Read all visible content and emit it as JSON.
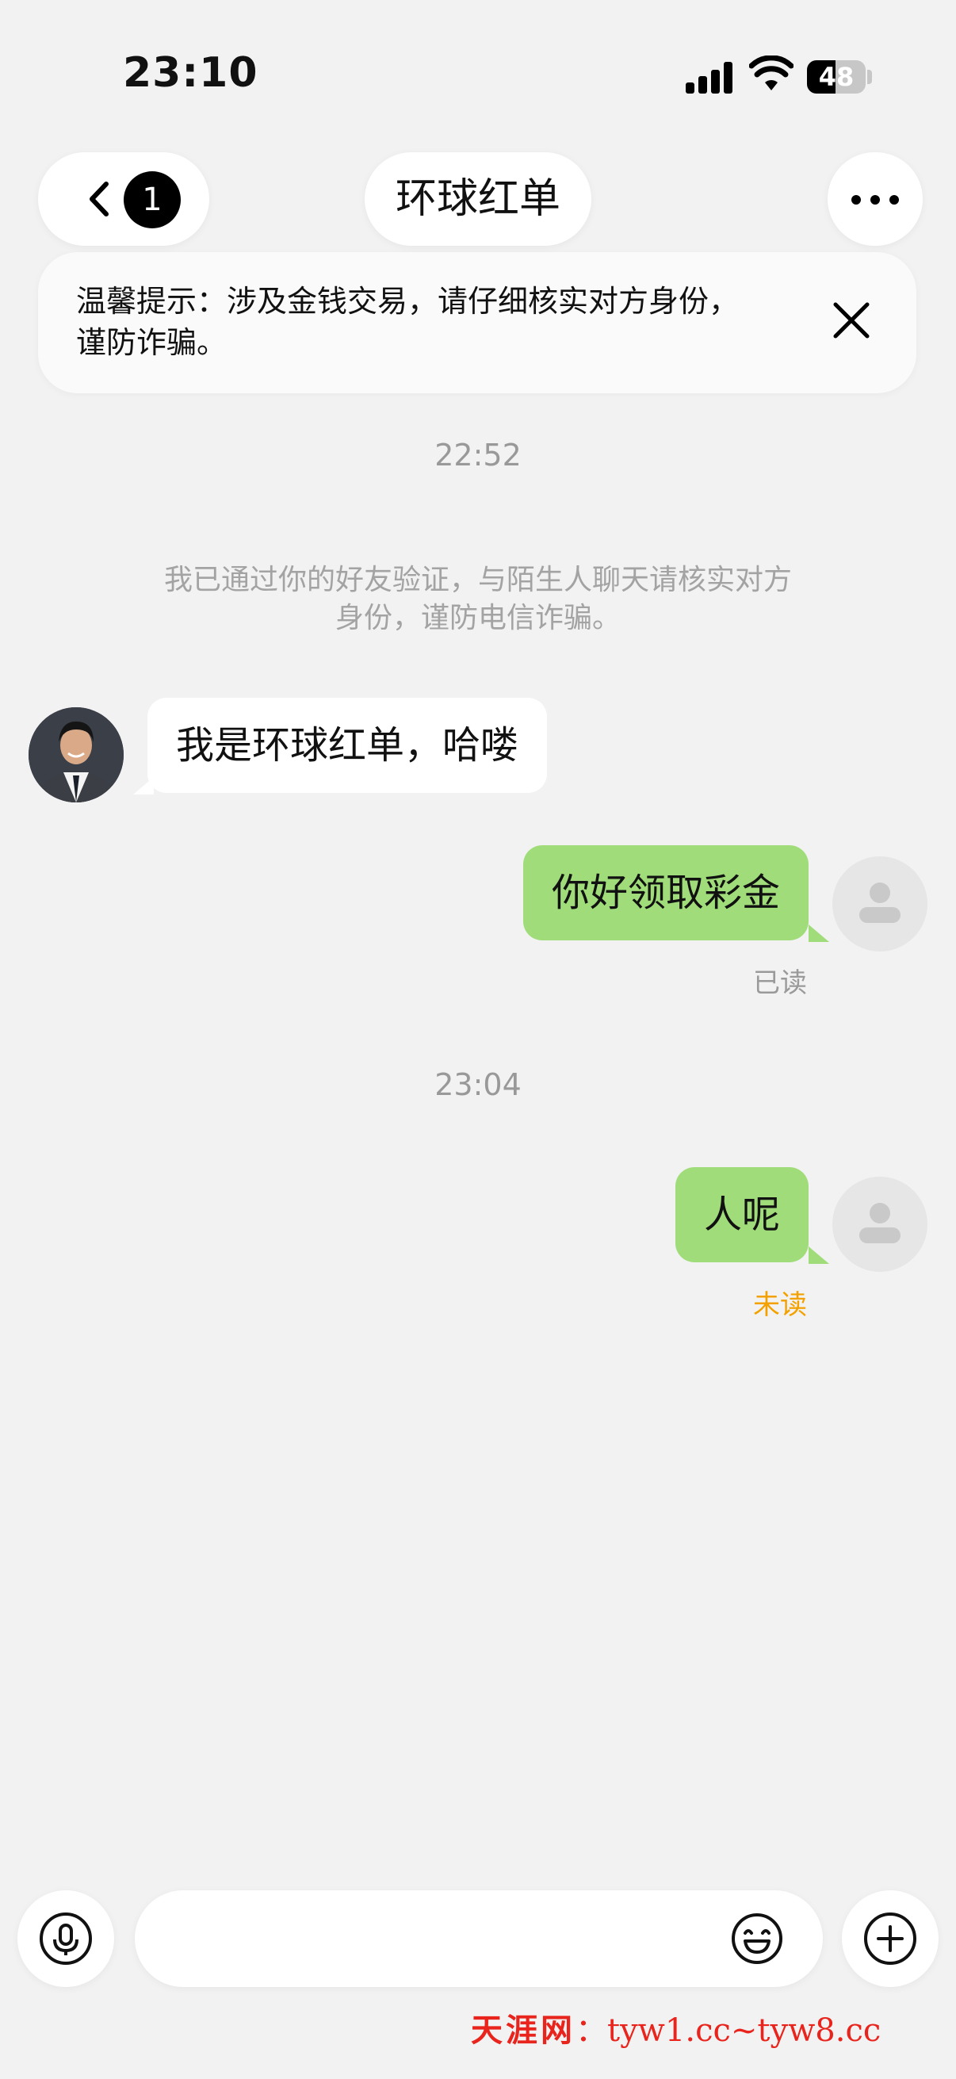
{
  "status_bar": {
    "time": "23:10",
    "battery": "48",
    "battery_level": 0.48
  },
  "header": {
    "back_badge": "1",
    "title": "环球红单"
  },
  "tip": {
    "text": "温馨提示：涉及金钱交易，请仔细核实对方身份，谨防诈骗。"
  },
  "chat": {
    "timestamp_1": "22:52",
    "system_notice": "我已通过你的好友验证，与陌生人聊天请核实对方身份，谨防电信诈骗。",
    "messages": [
      {
        "from": "contact",
        "text": "我是环球红单，哈喽"
      },
      {
        "from": "me",
        "text": "你好领取彩金",
        "status": "已读"
      },
      {
        "from": "me",
        "text": "人呢",
        "status": "未读"
      }
    ],
    "timestamp_2": "23:04"
  },
  "input_bar": {
    "placeholder": ""
  },
  "watermark": {
    "brand": "天涯网",
    "sep": "：",
    "urls": "tyw1.cc~tyw8.cc"
  },
  "colors": {
    "bubble_out": "#a0dd7a",
    "unread": "#f2a100",
    "watermark": "#e8241c"
  }
}
